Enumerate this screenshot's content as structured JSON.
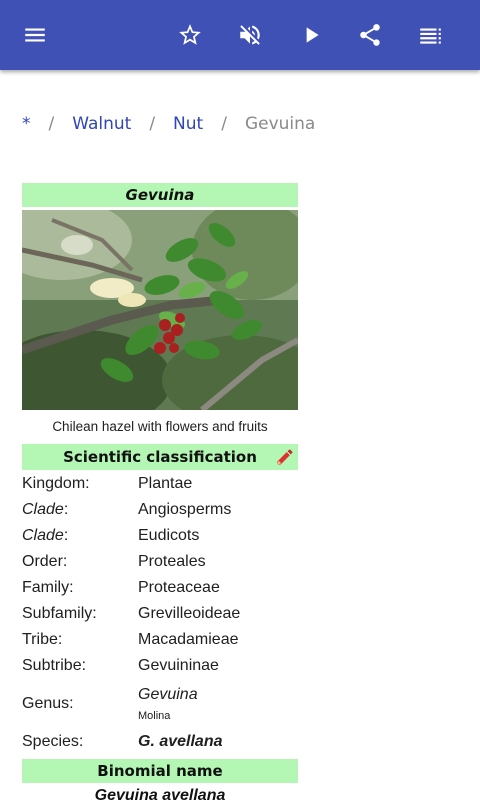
{
  "toolbar": {
    "icons": [
      "menu-icon",
      "star-icon",
      "volume-off-icon",
      "play-icon",
      "share-icon",
      "playlist-icon"
    ],
    "color": "#3f51b5"
  },
  "breadcrumb": {
    "items": [
      "*",
      "Walnut",
      "Nut"
    ],
    "separator": "/",
    "current": "Gevuina"
  },
  "infobox": {
    "title": "Gevuina",
    "image_caption": "Chilean hazel with flowers and fruits",
    "section_title": "Scientific classification",
    "rows": [
      {
        "key": "Kingdom:",
        "value": "Plantae"
      },
      {
        "key": "Clade",
        "value": "Angiosperms"
      },
      {
        "key": "Clade",
        "value": "Eudicots"
      },
      {
        "key": "Order:",
        "value": "Proteales"
      },
      {
        "key": "Family:",
        "value": "Proteaceae"
      },
      {
        "key": "Subfamily:",
        "value": "Grevilleoideae"
      },
      {
        "key": "Tribe:",
        "value": "Macadamieae"
      },
      {
        "key": "Subtribe:",
        "value": "Gevuininae"
      },
      {
        "key": "Genus:",
        "value": "Gevuina",
        "author": "Molina"
      },
      {
        "key": "Species:",
        "value": "G. avellana"
      }
    ],
    "clade_colon": ":",
    "binomial_title": "Binomial name",
    "binomial_value": "Gevuina avellana",
    "band_color": "#b4f7b4"
  }
}
